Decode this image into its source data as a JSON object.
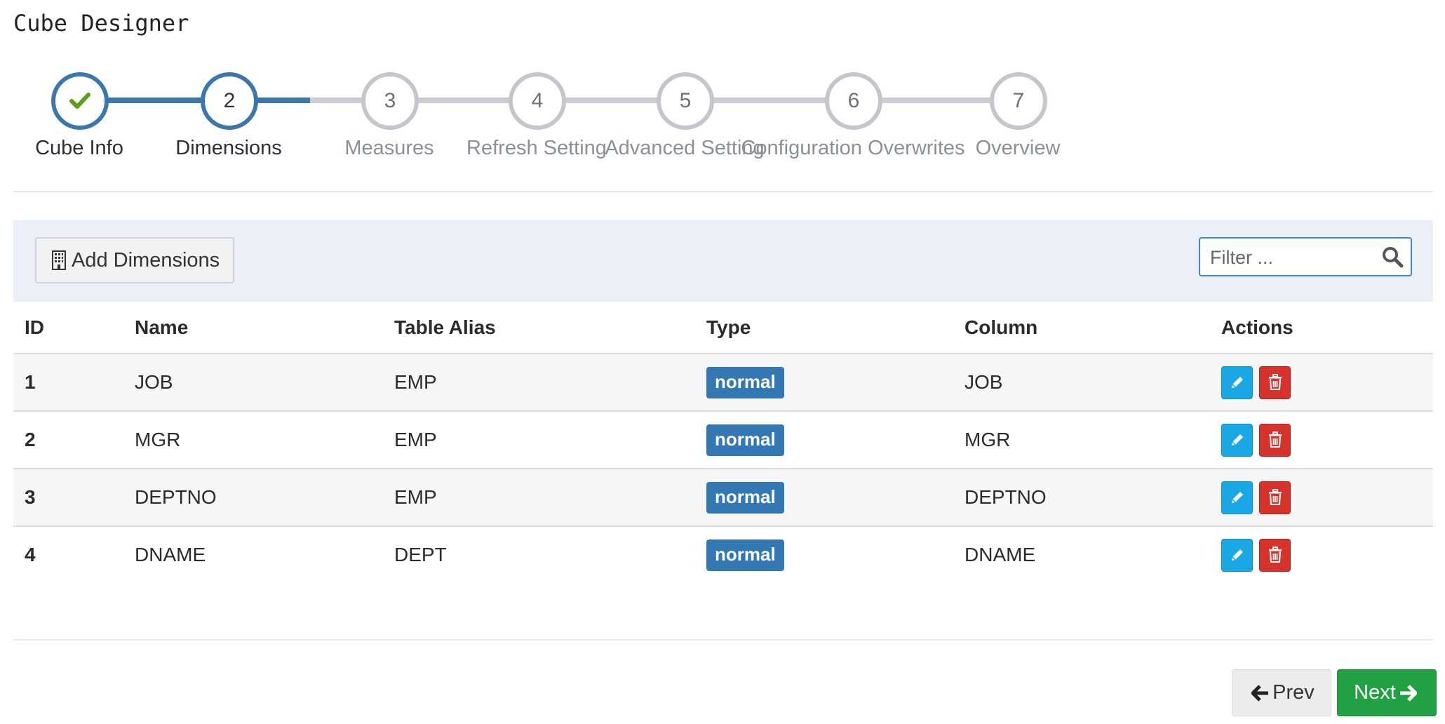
{
  "page": {
    "title": "Cube Designer"
  },
  "stepper": {
    "steps": [
      {
        "number": "1",
        "label": "Cube Info",
        "state": "done"
      },
      {
        "number": "2",
        "label": "Dimensions",
        "state": "active"
      },
      {
        "number": "3",
        "label": "Measures",
        "state": "pending"
      },
      {
        "number": "4",
        "label": "Refresh Setting",
        "state": "pending"
      },
      {
        "number": "5",
        "label": "Advanced Setting",
        "state": "pending"
      },
      {
        "number": "6",
        "label": "Configuration Overwrites",
        "state": "pending"
      },
      {
        "number": "7",
        "label": "Overview",
        "state": "pending"
      }
    ]
  },
  "toolbar": {
    "add_label": "Add Dimensions",
    "add_icon": "building-icon",
    "filter_placeholder": "Filter ...",
    "filter_value": ""
  },
  "table": {
    "headers": {
      "id": "ID",
      "name": "Name",
      "alias": "Table Alias",
      "type": "Type",
      "column": "Column",
      "actions": "Actions"
    },
    "rows": [
      {
        "id": "1",
        "name": "JOB",
        "alias": "EMP",
        "type": "normal",
        "column": "JOB"
      },
      {
        "id": "2",
        "name": "MGR",
        "alias": "EMP",
        "type": "normal",
        "column": "MGR"
      },
      {
        "id": "3",
        "name": "DEPTNO",
        "alias": "EMP",
        "type": "normal",
        "column": "DEPTNO"
      },
      {
        "id": "4",
        "name": "DNAME",
        "alias": "DEPT",
        "type": "normal",
        "column": "DNAME"
      }
    ]
  },
  "nav": {
    "prev_label": "Prev",
    "next_label": "Next"
  },
  "colors": {
    "primary": "#3a77ad",
    "pending": "#c3c6cc",
    "check": "#5a9e1a",
    "edit": "#1aa7e6",
    "delete": "#d6332d",
    "next": "#22a044"
  }
}
